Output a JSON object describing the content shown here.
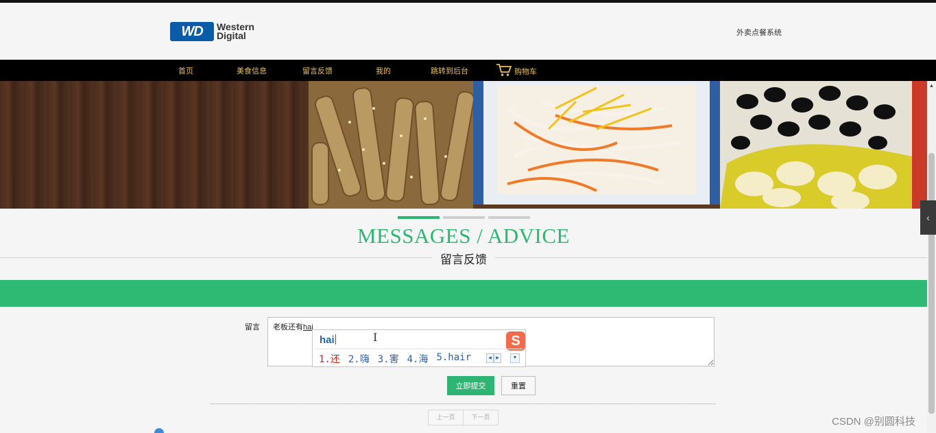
{
  "header": {
    "logo_mark": "WD",
    "logo_line1": "Western",
    "logo_line2": "Digital",
    "site_title": "外卖点餐系统"
  },
  "nav": {
    "items": [
      "首页",
      "美食信息",
      "留言反馈",
      "我的",
      "跳转到后台"
    ],
    "cart_label": "购物车"
  },
  "section": {
    "title_en": "MESSAGES / ADVICE",
    "title_cn": "留言反馈"
  },
  "form": {
    "label": "留言",
    "typed_prefix": "老板还有",
    "typed_pinyin": "hai",
    "submit_label": "立即提交",
    "reset_label": "重置"
  },
  "ime": {
    "composition": "hai",
    "logo": "S",
    "candidates": [
      "1.还",
      "2.嗨",
      "3.害",
      "4.海",
      "5.hair"
    ]
  },
  "pagination": {
    "prev_label": "上一页",
    "next_label": "下一页"
  },
  "watermark": "CSDN @别圆科技",
  "colors": {
    "accent": "#2fb573",
    "nav_bg": "#000000",
    "nav_text": "#f0c05a"
  }
}
